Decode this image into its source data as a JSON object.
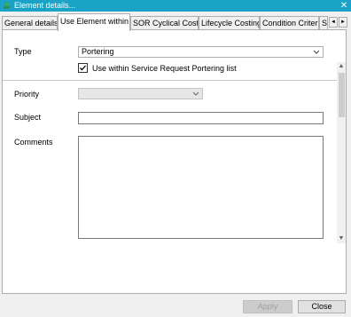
{
  "window": {
    "title": "Element details...",
    "close_glyph": "✕",
    "icon": "recycle-icon"
  },
  "tabs": [
    {
      "label": "General details",
      "active": false
    },
    {
      "label": "Use Element within ...",
      "active": true
    },
    {
      "label": "SOR Cyclical Costs",
      "active": false
    },
    {
      "label": "Lifecycle Costing",
      "active": false
    },
    {
      "label": "Condition Criteria",
      "active": false
    },
    {
      "label": "S",
      "active": false
    }
  ],
  "tab_nav": {
    "prev_glyph": "◄",
    "next_glyph": "►"
  },
  "form": {
    "type_label": "Type",
    "type_value": "Portering",
    "use_within_label": "Use within Service Request Portering list",
    "use_within_checked": true,
    "priority_label": "Priority",
    "priority_value": "",
    "subject_label": "Subject",
    "subject_value": "",
    "comments_label": "Comments",
    "comments_value": ""
  },
  "scroll": {
    "up_glyph": "▲",
    "down_glyph": "▼"
  },
  "buttons": {
    "apply_label": "Apply",
    "close_label": "Close"
  },
  "colors": {
    "titlebar": "#1aa3c7",
    "icon_green": "#3cb043"
  }
}
